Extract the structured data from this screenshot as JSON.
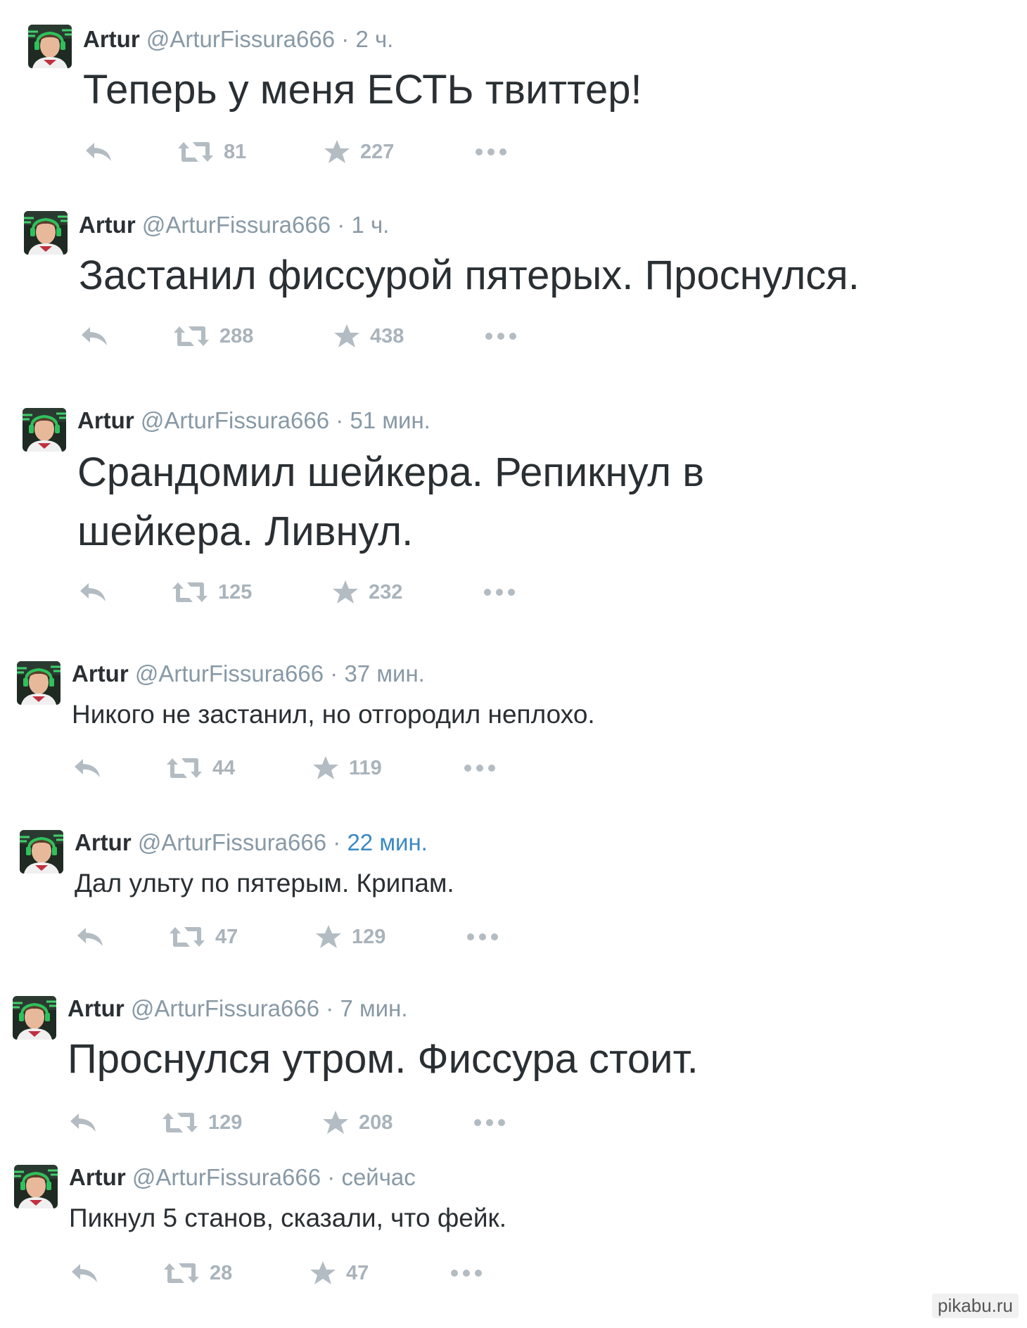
{
  "tweets": [
    {
      "name": "Artur",
      "handle": "@ArturFissura666",
      "time": "2 ч.",
      "text": "Теперь у меня ЕСТЬ твиттер!",
      "retweets": "81",
      "favorites": "227"
    },
    {
      "name": "Artur",
      "handle": "@ArturFissura666",
      "time": "1 ч.",
      "text": "Застанил фиссурой пятерых. Проснулся.",
      "retweets": "288",
      "favorites": "438"
    },
    {
      "name": "Artur",
      "handle": "@ArturFissura666",
      "time": "51 мин.",
      "text_line1": "Срандомил шейкера. Репикнул в",
      "text_line2": "шейкера. Ливнул.",
      "retweets": "125",
      "favorites": "232"
    },
    {
      "name": "Artur",
      "handle": "@ArturFissura666",
      "time": "37 мин.",
      "text": "Никого не застанил, но отгородил неплохо.",
      "retweets": "44",
      "favorites": "119"
    },
    {
      "name": "Artur",
      "handle": "@ArturFissura666",
      "time": "22 мин.",
      "text": "Дал ульту по пятерым. Крипам.",
      "retweets": "47",
      "favorites": "129"
    },
    {
      "name": "Artur",
      "handle": "@ArturFissura666",
      "time": "7 мин.",
      "text": "Проснулся утром. Фиссура стоит.",
      "retweets": "129",
      "favorites": "208"
    },
    {
      "name": "Artur",
      "handle": "@ArturFissura666",
      "time": "сейчас",
      "text": "Пикнул 5 станов, сказали, что фейк.",
      "retweets": "28",
      "favorites": "47"
    }
  ],
  "separator": "·",
  "watermark": "pikabu.ru",
  "icons": {
    "reply": "reply-icon",
    "retweet": "retweet-icon",
    "favorite": "star-icon",
    "more": "more-icon",
    "avatar": "avatar"
  },
  "colors": {
    "text": "#292f33",
    "muted": "#8899a6",
    "action": "#a9b3bb",
    "link": "#3b88c3"
  }
}
